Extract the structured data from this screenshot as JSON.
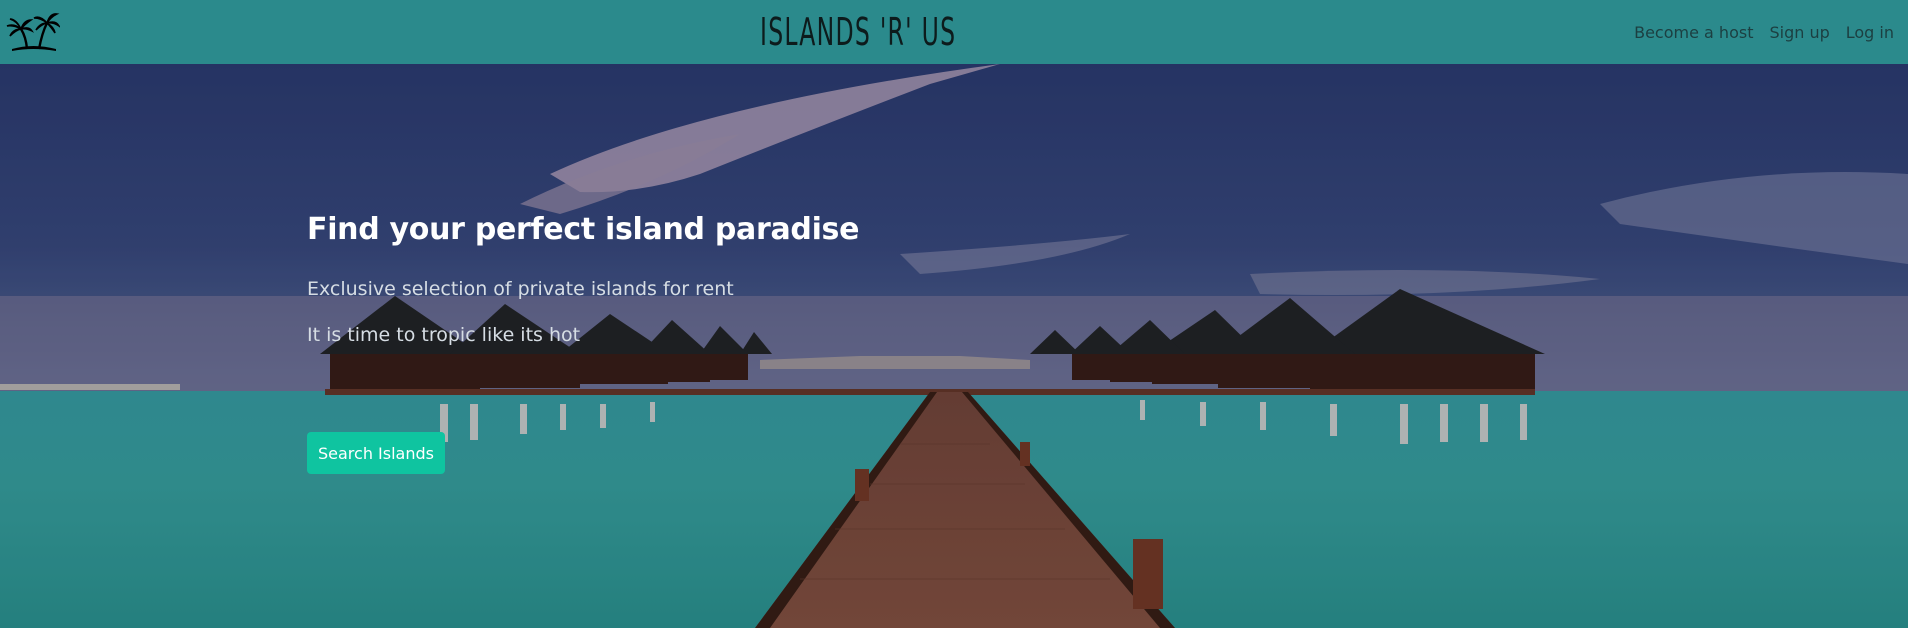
{
  "navbar": {
    "logo_icon": "palm-trees-island-icon",
    "brand": "ISLANDS 'R' US",
    "links": {
      "become_host": "Become a host",
      "sign_up": "Sign up",
      "log_in": "Log in"
    }
  },
  "hero": {
    "title": "Find your perfect island paradise",
    "subtitle": "Exclusive selection of private islands for rent",
    "tagline": "It is time to tropic like its hot",
    "cta_label": "Search Islands"
  },
  "colors": {
    "navbar": "#2b8a8c",
    "cta": "#0fc4a0",
    "sky": "#35477e",
    "water": "#3aa9ac"
  }
}
